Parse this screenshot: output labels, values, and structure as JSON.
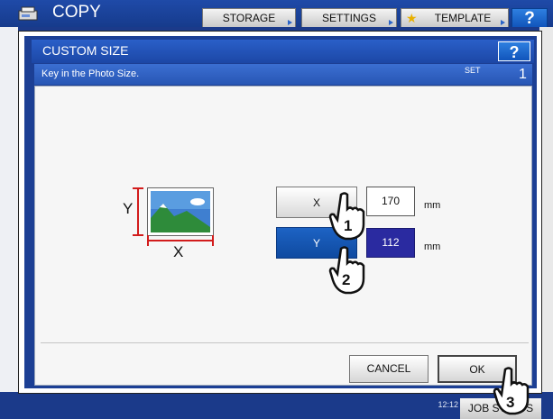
{
  "app": {
    "title": "COPY",
    "icon": "copier-icon"
  },
  "top_tabs": [
    {
      "label": "STORAGE",
      "icon": ""
    },
    {
      "label": "SETTINGS",
      "icon": ""
    },
    {
      "label": "TEMPLATE",
      "icon": "star-icon"
    }
  ],
  "help_label": "?",
  "dialog": {
    "title": "CUSTOM SIZE",
    "help_label": "?",
    "instruction": "Key in the Photo Size.",
    "set_label": "SET",
    "set_number": "1",
    "diagram": {
      "x_label": "X",
      "y_label": "Y"
    },
    "x_field": {
      "button_label": "X",
      "value": "170",
      "unit": "mm"
    },
    "y_field": {
      "button_label": "Y",
      "value": "112",
      "unit": "mm"
    },
    "cancel_label": "CANCEL",
    "ok_label": "OK"
  },
  "status": {
    "time": "12:12",
    "job_status_label": "JOB STATUS"
  },
  "callouts": [
    "1",
    "2",
    "3"
  ],
  "colors": {
    "accent": "#1c47a6",
    "selected": "#0f4aa0",
    "value_selected": "#2a2aa0",
    "dimension": "#d21c1c"
  }
}
